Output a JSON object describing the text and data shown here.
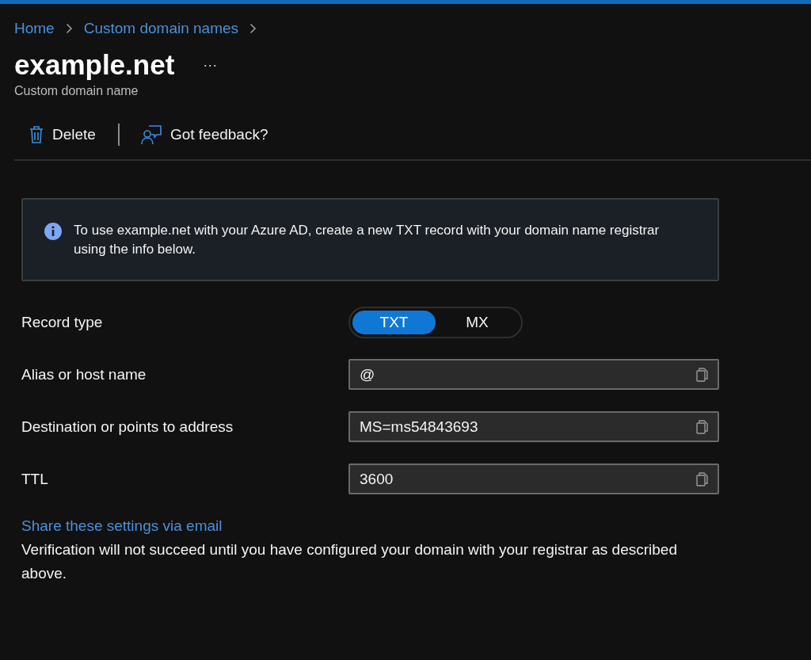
{
  "breadcrumb": [
    {
      "label": "Home"
    },
    {
      "label": "Custom domain names"
    }
  ],
  "page": {
    "title": "example.net",
    "more": "···",
    "subtitle": "Custom domain name"
  },
  "toolbar": [
    {
      "kind": "delete",
      "label": "Delete"
    },
    {
      "kind": "feedback",
      "label": "Got feedback?"
    }
  ],
  "info": {
    "text": "To use example.net with your Azure AD, create a new TXT record with your domain name registrar using the info below."
  },
  "record_type": {
    "label": "Record type",
    "options": [
      {
        "label": "TXT",
        "selected": true
      },
      {
        "label": "MX",
        "selected": false
      }
    ]
  },
  "fields": [
    {
      "label": "Alias or host name",
      "value": "@"
    },
    {
      "label": "Destination or points to address",
      "value": "MS=ms54843693"
    },
    {
      "label": "TTL",
      "value": "3600"
    }
  ],
  "share_link": "Share these settings via email",
  "note": "Verification will not succeed until you have configured your domain with your registrar as described above."
}
